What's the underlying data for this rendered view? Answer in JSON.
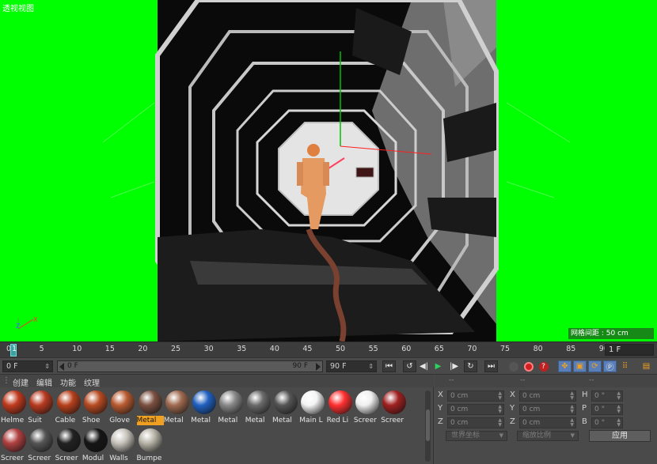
{
  "viewport": {
    "title": "透视视图",
    "grid_info": "网格间距 : 50 cm",
    "axis_x": "X",
    "axis_z": "Z"
  },
  "timeline": {
    "ticks": [
      "0",
      "5",
      "10",
      "15",
      "20",
      "25",
      "30",
      "35",
      "40",
      "45",
      "50",
      "55",
      "60",
      "65",
      "70",
      "75",
      "80",
      "85",
      "90"
    ],
    "current_frame_marker": "1",
    "end_field": "1 F"
  },
  "transport": {
    "start_frame": "0 F",
    "range_start": "0 F",
    "range_end": "90 F",
    "end_frame": "90 F"
  },
  "materials": {
    "menu": [
      "创建",
      "编辑",
      "功能",
      "纹理"
    ],
    "items": [
      {
        "name": "Helme",
        "color": "#c03a1e"
      },
      {
        "name": "Suit",
        "color": "#b83a20"
      },
      {
        "name": "Cable",
        "color": "#b8401c"
      },
      {
        "name": "Shoe",
        "color": "#b84a22"
      },
      {
        "name": "Glove",
        "color": "#b85a30"
      },
      {
        "name": "Metal",
        "color": "#7a5040",
        "selected": true
      },
      {
        "name": "Metal",
        "color": "#a06a50"
      },
      {
        "name": "Metal",
        "color": "#2060c0"
      },
      {
        "name": "Metal",
        "color": "#888888"
      },
      {
        "name": "Metal",
        "color": "#6a6a6a"
      },
      {
        "name": "Metal",
        "color": "#555555"
      },
      {
        "name": "Main L",
        "color": "#f4f4f4"
      },
      {
        "name": "Red Li",
        "color": "#ff3030"
      },
      {
        "name": "Screer",
        "color": "#f0f0f0"
      },
      {
        "name": "Screer",
        "color": "#a02020"
      },
      {
        "name": "Screer",
        "color": "#b04040"
      },
      {
        "name": "Screer",
        "color": "#555555"
      },
      {
        "name": "Screer",
        "color": "#222222"
      },
      {
        "name": "Modul",
        "color": "#151515"
      },
      {
        "name": "Walls",
        "color": "#c8c4bc"
      },
      {
        "name": "Bumpe",
        "color": "#b8b4a8"
      }
    ]
  },
  "coordinates": {
    "header": [
      "--",
      "--",
      "--"
    ],
    "rows": [
      {
        "pos_axis": "X",
        "pos": "0 cm",
        "size_axis": "X",
        "size": "0 cm",
        "rot_axis": "H",
        "rot": "0 °"
      },
      {
        "pos_axis": "Y",
        "pos": "0 cm",
        "size_axis": "Y",
        "size": "0 cm",
        "rot_axis": "P",
        "rot": "0 °"
      },
      {
        "pos_axis": "Z",
        "pos": "0 cm",
        "size_axis": "Z",
        "size": "0 cm",
        "rot_axis": "B",
        "rot": "0 °"
      }
    ],
    "mode_world": "世界坐标",
    "mode_scale": "缩放比例",
    "apply": "应用"
  }
}
